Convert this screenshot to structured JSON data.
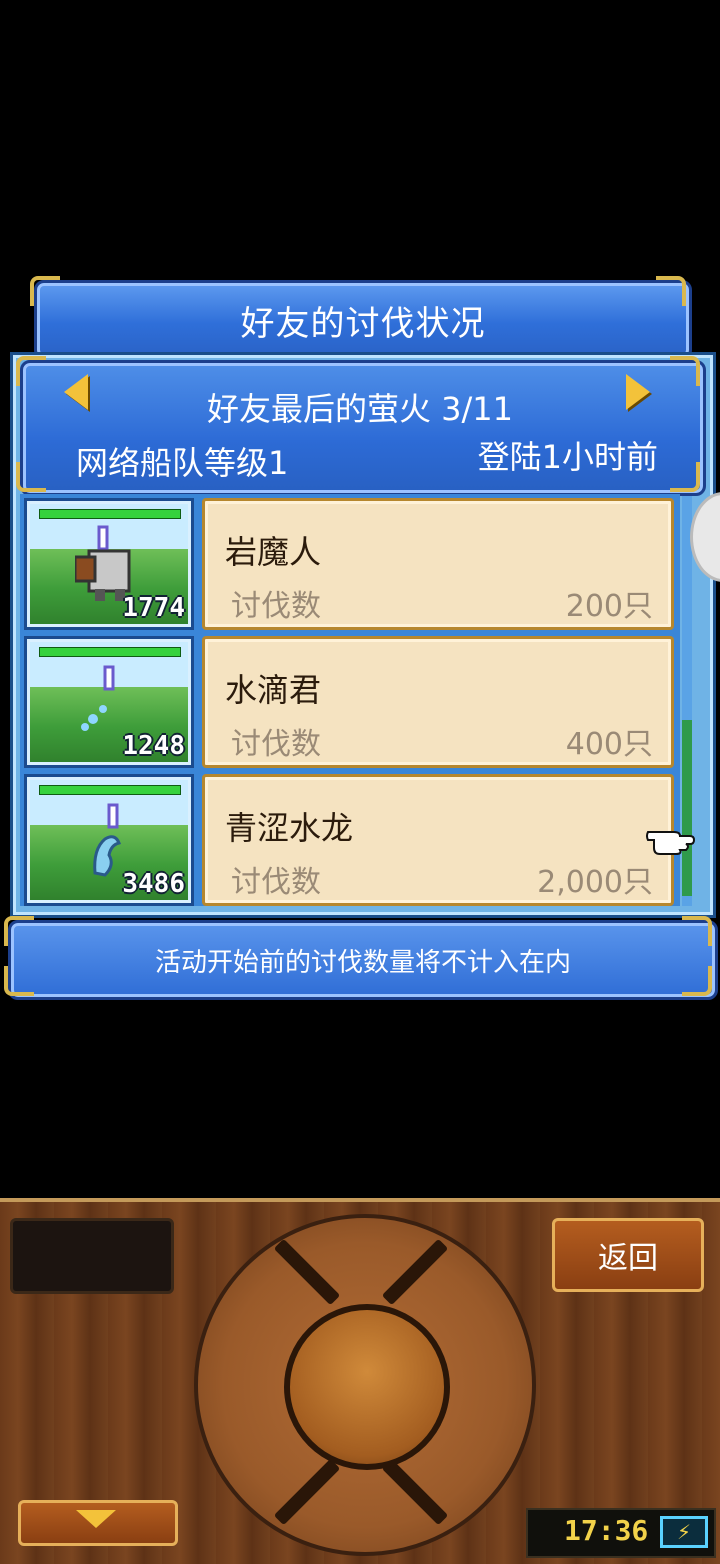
{
  "title": "好友的讨伐状况",
  "friend": {
    "name_line": "好友最后的萤火 3/11",
    "fleet_level": "网络船队等级1",
    "last_login": "登陆1小时前"
  },
  "kill_label": "讨伐数",
  "monsters": [
    {
      "name": "岩魔人",
      "kills": "200只",
      "number": "1774"
    },
    {
      "name": "水滴君",
      "kills": "400只",
      "number": "1248"
    },
    {
      "name": "青涩水龙",
      "kills": "2,000只",
      "number": "3486"
    }
  ],
  "notice": "活动开始前的讨伐数量将不计入在内",
  "controls": {
    "back_label": "返回",
    "clock": "17:36",
    "battery_icon": "⚡"
  },
  "icons": {
    "prev": "arrow-left-icon",
    "next": "arrow-right-icon",
    "pointer": "hand-pointer-icon",
    "down": "arrow-down-icon",
    "battery": "battery-icon"
  }
}
